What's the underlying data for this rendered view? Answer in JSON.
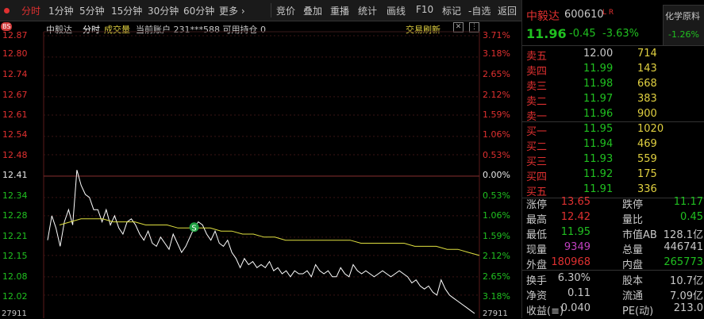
{
  "toolbar": {
    "periods": [
      "分时",
      "1分钟",
      "5分钟",
      "15分钟",
      "30分钟",
      "60分钟",
      "更多 ›"
    ],
    "tools": [
      "竞价",
      "叠加",
      "重播",
      "统计",
      "画线",
      "F10",
      "标记",
      "-自选",
      "返回"
    ]
  },
  "chart_header": {
    "name": "中毅达",
    "mode": "分时",
    "volume_label": "成交量",
    "account": "当前账户 231***588 可用持仓 0",
    "refresh": "交易刷新",
    "bs_badge": "BS"
  },
  "stock": {
    "name": "中毅达",
    "code": "600610",
    "tags": "L R",
    "price": "11.96",
    "change": "-0.45",
    "change_pct": "-3.63%",
    "sector": "化学原料",
    "sector_pct": "-1.26%"
  },
  "order_book": {
    "asks": [
      {
        "label": "卖五",
        "price": "12.00",
        "vol": "714"
      },
      {
        "label": "卖四",
        "price": "11.99",
        "vol": "143"
      },
      {
        "label": "卖三",
        "price": "11.98",
        "vol": "668"
      },
      {
        "label": "卖二",
        "price": "11.97",
        "vol": "383"
      },
      {
        "label": "卖一",
        "price": "11.96",
        "vol": "900"
      }
    ],
    "bids": [
      {
        "label": "买一",
        "price": "11.95",
        "vol": "1020"
      },
      {
        "label": "买二",
        "price": "11.94",
        "vol": "469"
      },
      {
        "label": "买三",
        "price": "11.93",
        "vol": "559"
      },
      {
        "label": "买四",
        "price": "11.92",
        "vol": "175"
      },
      {
        "label": "买五",
        "price": "11.91",
        "vol": "336"
      }
    ]
  },
  "stats": [
    {
      "l1": "涨停",
      "v1": "13.65",
      "c1": "#e03030",
      "l2": "跌停",
      "v2": "11.17",
      "c2": "#20c020"
    },
    {
      "l1": "最高",
      "v1": "12.42",
      "c1": "#e03030",
      "l2": "量比",
      "v2": "0.45",
      "c2": "#20c020"
    },
    {
      "l1": "最低",
      "v1": "11.95",
      "c1": "#20c020",
      "l2": "市值AB",
      "v2": "128.1亿",
      "c2": "#c8c8c8"
    },
    {
      "l1": "现量",
      "v1": "9349",
      "c1": "#c040c0",
      "l2": "总量",
      "v2": "446741",
      "c2": "#c8c8c8"
    },
    {
      "l1": "外盘",
      "v1": "180968",
      "c1": "#e03030",
      "l2": "内盘",
      "v2": "265773",
      "c2": "#20c020"
    },
    {
      "l1": "换手",
      "v1": "6.30%",
      "c1": "#c8c8c8",
      "l2": "股本",
      "v2": "10.7亿",
      "c2": "#c8c8c8"
    },
    {
      "l1": "净资",
      "v1": "0.11",
      "c1": "#c8c8c8",
      "l2": "流通",
      "v2": "7.09亿",
      "c2": "#c8c8c8"
    },
    {
      "l1": "收益(≡)",
      "v1": "0.040",
      "c1": "#c8c8c8",
      "l2": "PE(动)",
      "v2": "213.0",
      "c2": "#c8c8c8"
    }
  ],
  "chart_data": {
    "type": "line",
    "title": "",
    "prev_close": 12.41,
    "ylim": [
      11.96,
      12.87
    ],
    "y_ticks": [
      "12.87",
      "12.80",
      "12.74",
      "12.67",
      "12.61",
      "12.54",
      "12.48",
      "12.41",
      "12.34",
      "12.28",
      "12.21",
      "12.15",
      "12.08",
      "12.02"
    ],
    "pct_ticks": [
      "3.71%",
      "3.18%",
      "2.65%",
      "2.12%",
      "1.59%",
      "1.06%",
      "0.53%",
      "0.00%",
      "0.53%",
      "1.06%",
      "1.59%",
      "2.12%",
      "2.65%",
      "3.18%"
    ],
    "bottom_left_label": "27911",
    "bottom_right_label": "27911",
    "trade_marker": "S",
    "series": [
      {
        "values": [
          12.2,
          12.28,
          12.24,
          12.18,
          12.26,
          12.3,
          12.25,
          12.43,
          12.38,
          12.35,
          12.34,
          12.3,
          12.3,
          12.26,
          12.3,
          12.25,
          12.28,
          12.24,
          12.22,
          12.26,
          12.27,
          12.25,
          12.22,
          12.2,
          12.23,
          12.19,
          12.18,
          12.21,
          12.19,
          12.17,
          12.22,
          12.19,
          12.16,
          12.18,
          12.21,
          12.24,
          12.26,
          12.25,
          12.22,
          12.2,
          12.23,
          12.19,
          12.18,
          12.2,
          12.16,
          12.14,
          12.11,
          12.14,
          12.12,
          12.13,
          12.11,
          12.12,
          12.11,
          12.13,
          12.1,
          12.11,
          12.09,
          12.1,
          12.08,
          12.1,
          12.09,
          12.09,
          12.1,
          12.08,
          12.12,
          12.1,
          12.09,
          12.1,
          12.08,
          12.08,
          12.11,
          12.09,
          12.08,
          12.12,
          12.1,
          12.09,
          12.1,
          12.09,
          12.08,
          12.09,
          12.1,
          12.09,
          12.08,
          12.09,
          12.1,
          12.09,
          12.08,
          12.06,
          12.07,
          12.05,
          12.04,
          12.05,
          12.03,
          12.02,
          12.07,
          12.04,
          12.02,
          12.01,
          12.0,
          11.99,
          11.98,
          11.97,
          11.96
        ]
      },
      {
        "values": [
          12.25,
          12.26,
          12.27,
          12.27,
          12.27,
          12.26,
          12.26,
          12.26,
          12.25,
          12.25,
          12.25,
          12.24,
          12.24,
          12.24,
          12.24,
          12.23,
          12.23,
          12.22,
          12.22,
          12.21,
          12.21,
          12.2,
          12.2,
          12.2,
          12.2,
          12.2,
          12.2,
          12.2,
          12.19,
          12.19,
          12.19,
          12.19,
          12.19,
          12.18,
          12.18,
          12.18,
          12.17,
          12.17,
          12.16,
          12.15
        ]
      }
    ]
  }
}
